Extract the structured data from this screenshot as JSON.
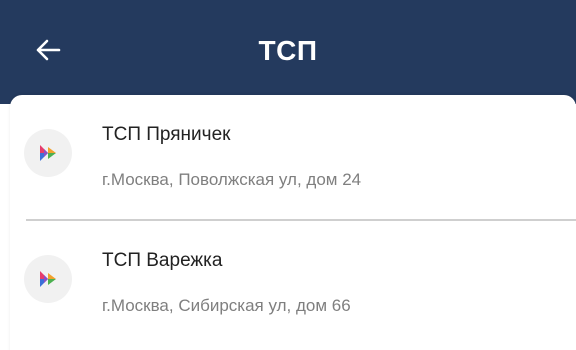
{
  "header": {
    "title": "ТСП",
    "back_icon": "arrow-left-icon",
    "background_color": "#243a5e"
  },
  "merchants": [
    {
      "name": "ТСП Пряничек",
      "address": "г.Москва, Поволжская ул, дом 24",
      "logo_icon": "merchant-logo-icon"
    },
    {
      "name": "ТСП Варежка",
      "address": "г.Москва, Сибирская ул, дом 66",
      "logo_icon": "merchant-logo-icon"
    }
  ]
}
